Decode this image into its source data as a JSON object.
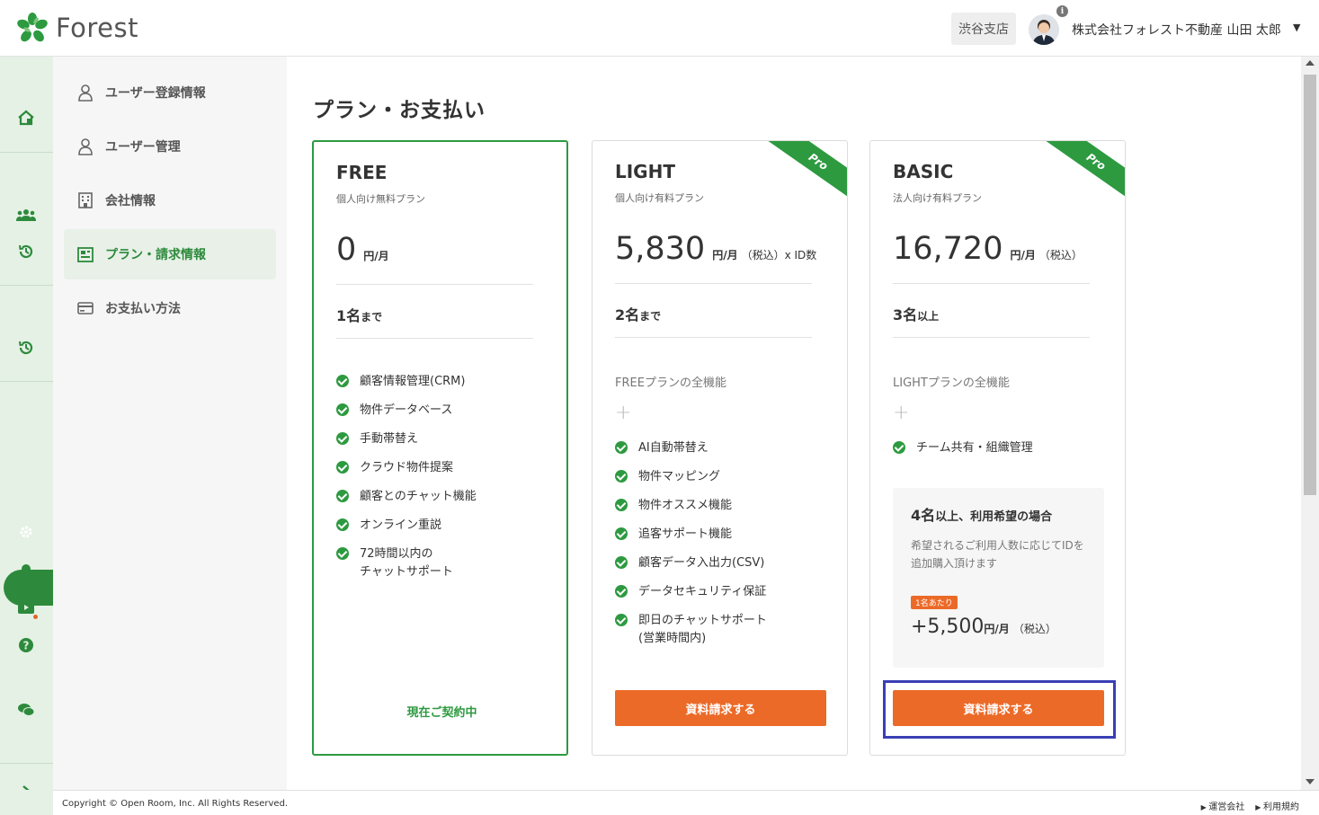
{
  "header": {
    "logo_text": "Forest",
    "branch": "渋谷支店",
    "user": "株式会社フォレスト不動産 山田 太郎",
    "caret": "▼",
    "info": "i"
  },
  "rail": {
    "icons": [
      "home-icon",
      "users-icon",
      "history-icon",
      "history-icon",
      "settings-icon",
      "bell-icon",
      "video-icon",
      "help-icon",
      "chat-icon",
      "chevron-right-icon"
    ]
  },
  "sidebar": {
    "items": [
      {
        "label": "ユーザー登録情報",
        "icon": "user-icon"
      },
      {
        "label": "ユーザー管理",
        "icon": "user-icon"
      },
      {
        "label": "会社情報",
        "icon": "building-icon"
      },
      {
        "label": "プラン・請求情報",
        "icon": "billing-icon",
        "active": true
      },
      {
        "label": "お支払い方法",
        "icon": "credit-card-icon"
      }
    ]
  },
  "page": {
    "title": "プラン・お支払い"
  },
  "plans": [
    {
      "name": "FREE",
      "desc": "個人向け無料プラン",
      "price": "0",
      "unit": "円/月",
      "tax": "",
      "seats": "1名",
      "seats_suffix": "まで",
      "features": [
        "顧客情報管理(CRM)",
        "物件データベース",
        "手動帯替え",
        "クラウド物件提案",
        "顧客とのチャット機能",
        "オンライン重説",
        "72時間以内の\nチャットサポート"
      ],
      "status": "現在ご契約中"
    },
    {
      "name": "LIGHT",
      "desc": "個人向け有料プラン",
      "price": "5,830",
      "unit": "円/月",
      "tax": "（税込）x ID数",
      "seats": "2名",
      "seats_suffix": "まで",
      "ribbon": "Pro",
      "inherit": "FREEプランの全機能",
      "plus": "+",
      "features": [
        "AI自動帯替え",
        "物件マッピング",
        "物件オススメ機能",
        "追客サポート機能",
        "顧客データ入出力(CSV)",
        "データセキュリティ保証",
        "即日のチャットサポート\n(営業時間内)"
      ],
      "cta": "資料請求する"
    },
    {
      "name": "BASIC",
      "desc": "法人向け有料プラン",
      "price": "16,720",
      "unit": "円/月",
      "tax": "（税込）",
      "seats": "3名",
      "seats_suffix": "以上",
      "ribbon": "Pro",
      "inherit": "LIGHTプランの全機能",
      "plus": "+",
      "features": [
        "チーム共有・組織管理"
      ],
      "addon": {
        "title_num": "4名",
        "title_rest": "以上、利用希望の場合",
        "desc": "希望されるご利用人数に応じてIDを追加購入頂けます",
        "badge": "1名あたり",
        "price": "+5,500",
        "unit": "円/月",
        "tax": "（税込）"
      },
      "cta": "資料請求する"
    }
  ],
  "footer": {
    "copyright": "Copyright © Open Room, Inc. All Rights Reserved.",
    "link1": "運営会社",
    "link2": "利用規約"
  },
  "colors": {
    "brand_green": "#2d9a40",
    "cta_orange": "#ec6a28",
    "highlight": "#3a3fb5"
  }
}
